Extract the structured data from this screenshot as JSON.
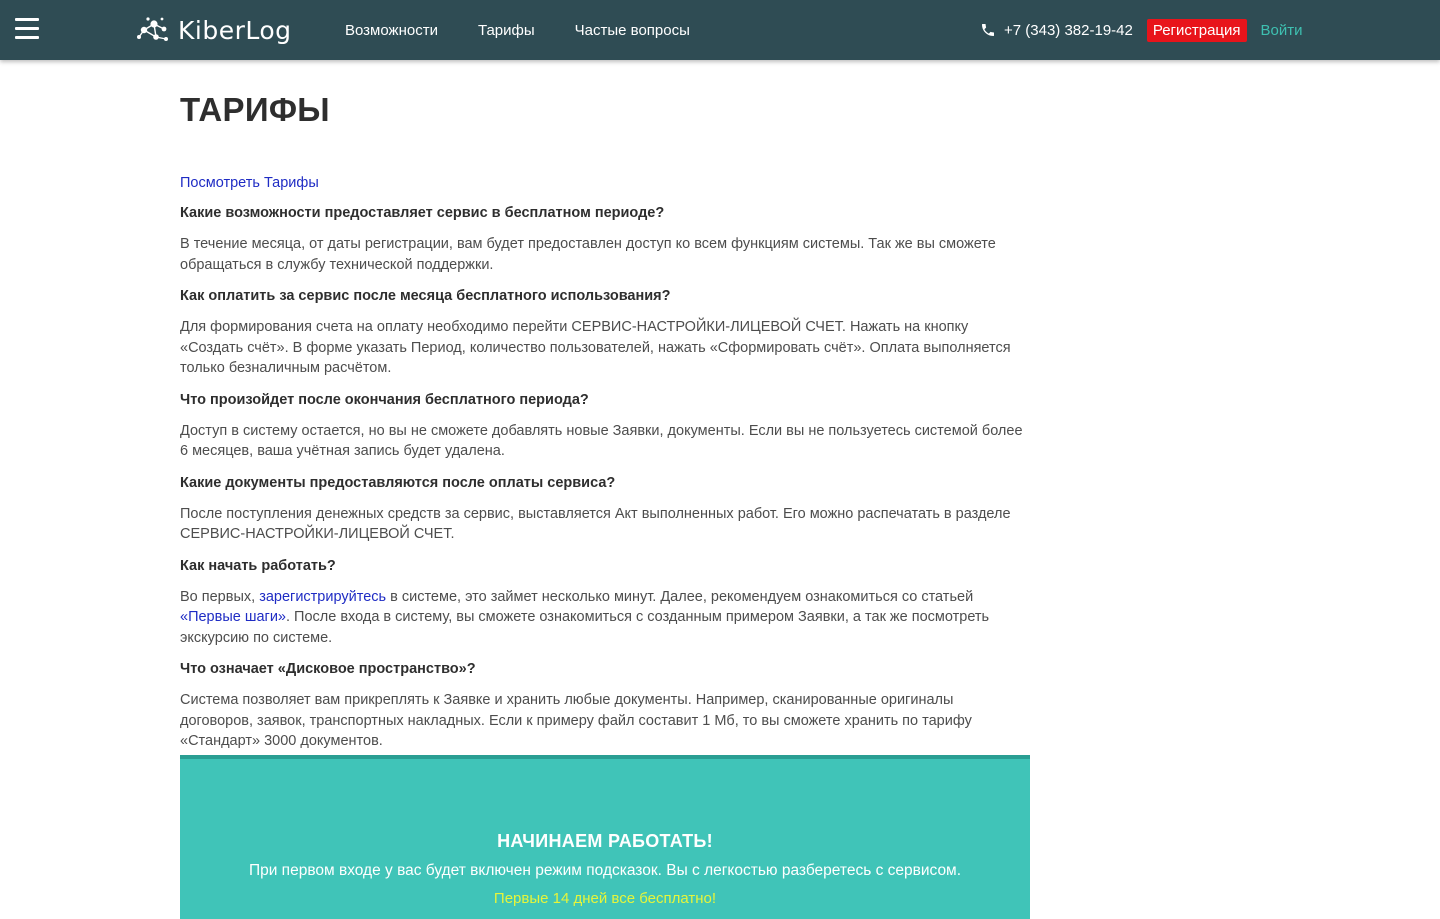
{
  "header": {
    "logo_text": "KiberLog",
    "nav": [
      "Возможности",
      "Тарифы",
      "Частые вопросы"
    ],
    "phone": "+7 (343) 382-19-42",
    "register_label": "Регистрация",
    "login_label": "Войти"
  },
  "page": {
    "title": "ТАРИФЫ",
    "view_tariffs_link": "Посмотреть Тарифы"
  },
  "faq": [
    {
      "question": "Какие возможности предоставляет сервис в бесплатном периоде?",
      "answer": "В течение месяца, от даты регистрации, вам будет предоставлен доступ ко всем функциям системы. Так же вы сможете обращаться в службу технической поддержки."
    },
    {
      "question": "Как оплатить за сервис после месяца бесплатного использования?",
      "answer": "Для формирования счета на оплату необходимо перейти СЕРВИС-НАСТРОЙКИ-ЛИЦЕВОЙ СЧЕТ. Нажать на кнопку «Создать счёт». В форме указать Период, количество пользователей, нажать «Сформировать счёт». Оплата выполняется только безналичным расчётом."
    },
    {
      "question": "Что произойдет после окончания бесплатного периода?",
      "answer": "Доступ в систему остается, но вы не сможете добавлять новые Заявки, документы. Если вы не пользуетесь системой более 6 месяцев, ваша учётная запись будет удалена."
    },
    {
      "question": "Какие документы предоставляются после оплаты сервиса?",
      "answer": "После поступления денежных средств за сервис, выставляется Акт выполненных работ. Его можно распечатать в разделе СЕРВИС-НАСТРОЙКИ-ЛИЦЕВОЙ СЧЕТ."
    },
    {
      "question": "Как начать работать?",
      "answer_parts": {
        "p1": "Во первых, ",
        "link1": "зарегистрируйтесь",
        "p2": " в системе, это займет несколько минут. Далее, рекомендуем ознакомиться со статьей ",
        "link2": "«Первые шаги»",
        "p3": ". После входа в систему, вы сможете ознакомиться с созданным примером Заявки, а так же посмотреть экскурсию по системе."
      }
    },
    {
      "question": "Что означает «Дисковое пространство»?",
      "answer": "Система позволяет вам прикреплять к Заявке и хранить любые документы. Например, сканированные оригиналы договоров, заявок, транспортных накладных. Если к примеру файл составит 1 Мб, то вы сможете хранить по тарифу «Стандарт» 3000 документов."
    }
  ],
  "cta": {
    "title": "НАЧИНАЕМ РАБОТАТЬ!",
    "text": "При первом входе у вас будет включен режим подсказок. Вы с легкостью разберетесь с сервисом.",
    "promo": "Первые 14 дней все бесплатно!"
  },
  "colors": {
    "header_bg": "#2f4c54",
    "register_bg": "#e8141b",
    "login": "#3ec0b1",
    "cta_bg": "#40c4b8",
    "link": "#1f2cc4"
  },
  "icons": [
    "menu-icon",
    "logo-molecule-icon",
    "phone-icon"
  ]
}
